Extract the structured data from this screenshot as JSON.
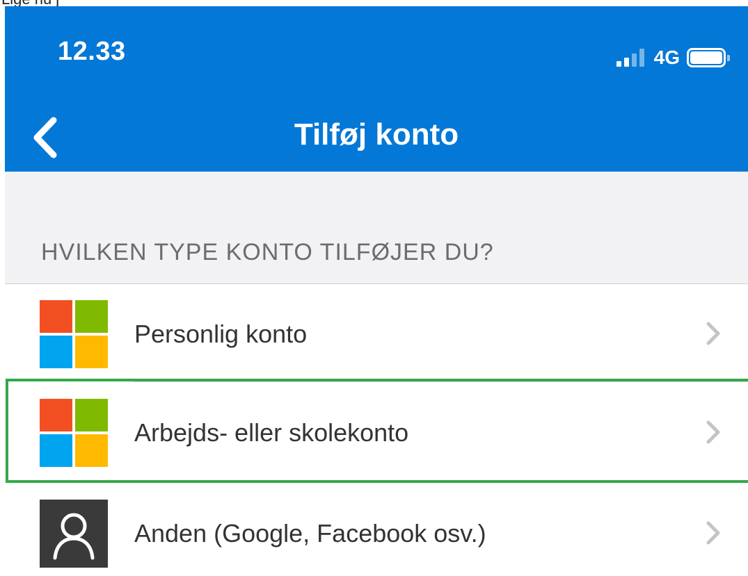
{
  "top_strip_text": "Lige nu j",
  "status_bar": {
    "time": "12.33",
    "network": "4G"
  },
  "nav": {
    "title": "Tilføj konto"
  },
  "section": {
    "label": "HVILKEN TYPE KONTO TILFØJER DU?"
  },
  "accounts": [
    {
      "label": "Personlig konto",
      "icon": "microsoft-logo-icon"
    },
    {
      "label": "Arbejds- eller skolekonto",
      "icon": "microsoft-logo-icon",
      "highlighted": true
    },
    {
      "label": "Anden (Google, Facebook osv.)",
      "icon": "person-icon"
    }
  ],
  "colors": {
    "header_blue": "#0478d7",
    "highlight_green": "#34a84a",
    "ms_red": "#f25022",
    "ms_green": "#7fba00",
    "ms_blue": "#00a4ef",
    "ms_yellow": "#ffb900"
  }
}
